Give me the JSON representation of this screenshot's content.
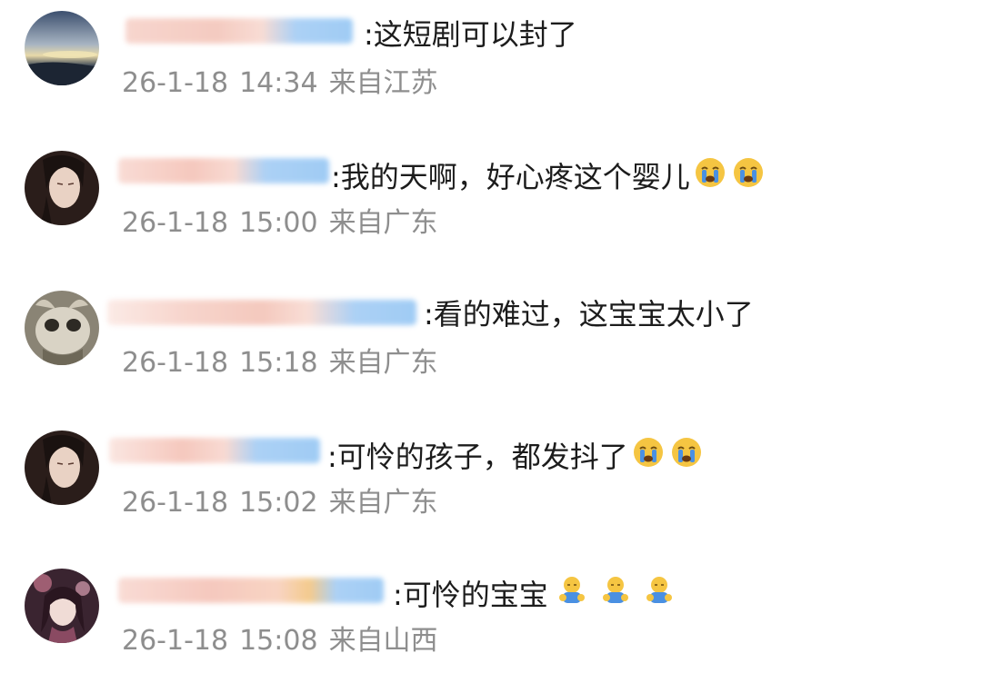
{
  "comments": [
    {
      "text": ":这短剧可以封了",
      "date": "26-1-18",
      "time": "14:34",
      "location": "来自江苏",
      "emojis": []
    },
    {
      "text": ":我的天啊，好心疼这个婴儿",
      "date": "26-1-18",
      "time": "15:00",
      "location": "来自广东",
      "emojis": [
        "crying-face-icon",
        "crying-face-icon"
      ]
    },
    {
      "text": ":看的难过，这宝宝太小了",
      "date": "26-1-18",
      "time": "15:18",
      "location": "来自广东",
      "emojis": []
    },
    {
      "text": ":可怜的孩子，都发抖了",
      "date": "26-1-18",
      "time": "15:02",
      "location": "来自广东",
      "emojis": [
        "crying-face-icon",
        "crying-face-icon"
      ]
    },
    {
      "text": ":可怜的宝宝",
      "date": "26-1-18",
      "time": "15:08",
      "location": "来自山西",
      "emojis": [
        "sad-figure-icon",
        "sad-figure-icon",
        "sad-figure-icon"
      ]
    }
  ],
  "colors": {
    "blur_pink": "#f6c9bf",
    "blur_blue": "#8fc3f3",
    "meta_gray": "#8e8e8e",
    "emoji_yellow": "#f5c542",
    "emoji_blue": "#4a90e2"
  }
}
